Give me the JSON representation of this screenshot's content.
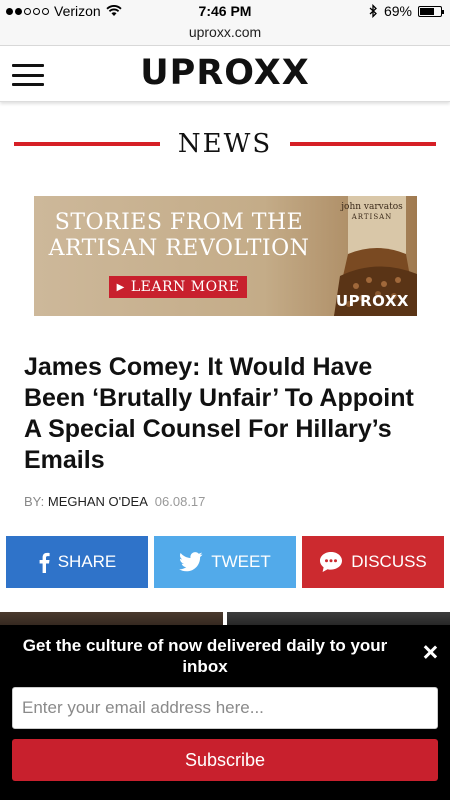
{
  "status_bar": {
    "carrier": "Verizon",
    "time": "7:46 PM",
    "battery": "69%",
    "battery_level": 0.69,
    "signal_bars": 2
  },
  "browser": {
    "url": "uproxx.com"
  },
  "header": {
    "logo": "UPROXX"
  },
  "section": {
    "title": "NEWS"
  },
  "ad": {
    "headline_line1": "STORIES FROM THE",
    "headline_line2": "ARTISAN REVOLTION",
    "cta": "LEARN MORE",
    "brand": "john varvatos",
    "brand_sub": "ARTISAN",
    "logo": "UPROXX"
  },
  "article": {
    "headline": "James Comey: It Would Have Been ‘Brutally Unfair’ To Appoint A Special Counsel For Hillary’s Emails",
    "byline_prefix": "BY:",
    "author": "MEGHAN O'DEA",
    "date": "06.08.17"
  },
  "share": {
    "facebook_label": "SHARE",
    "twitter_label": "TWEET",
    "discuss_label": "DISCUSS"
  },
  "newsletter": {
    "text": "Get the culture of now delivered daily to your inbox",
    "input_placeholder": "Enter your email address here...",
    "submit_label": "Subscribe"
  },
  "colors": {
    "accent_red": "#d61f26",
    "facebook_blue": "#2f73c9",
    "twitter_blue": "#52aaea",
    "discuss_red": "#cc2a2f",
    "subscribe_red": "#c8202d"
  }
}
